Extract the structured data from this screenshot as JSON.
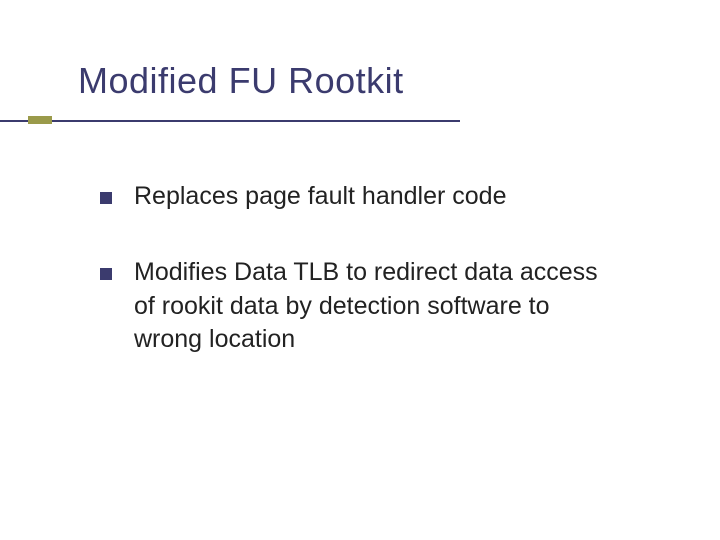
{
  "slide": {
    "title": "Modified FU Rootkit",
    "bullets": [
      "Replaces page fault handler code",
      "Modifies Data TLB to redirect data access of rookit data by detection software to wrong location"
    ]
  }
}
